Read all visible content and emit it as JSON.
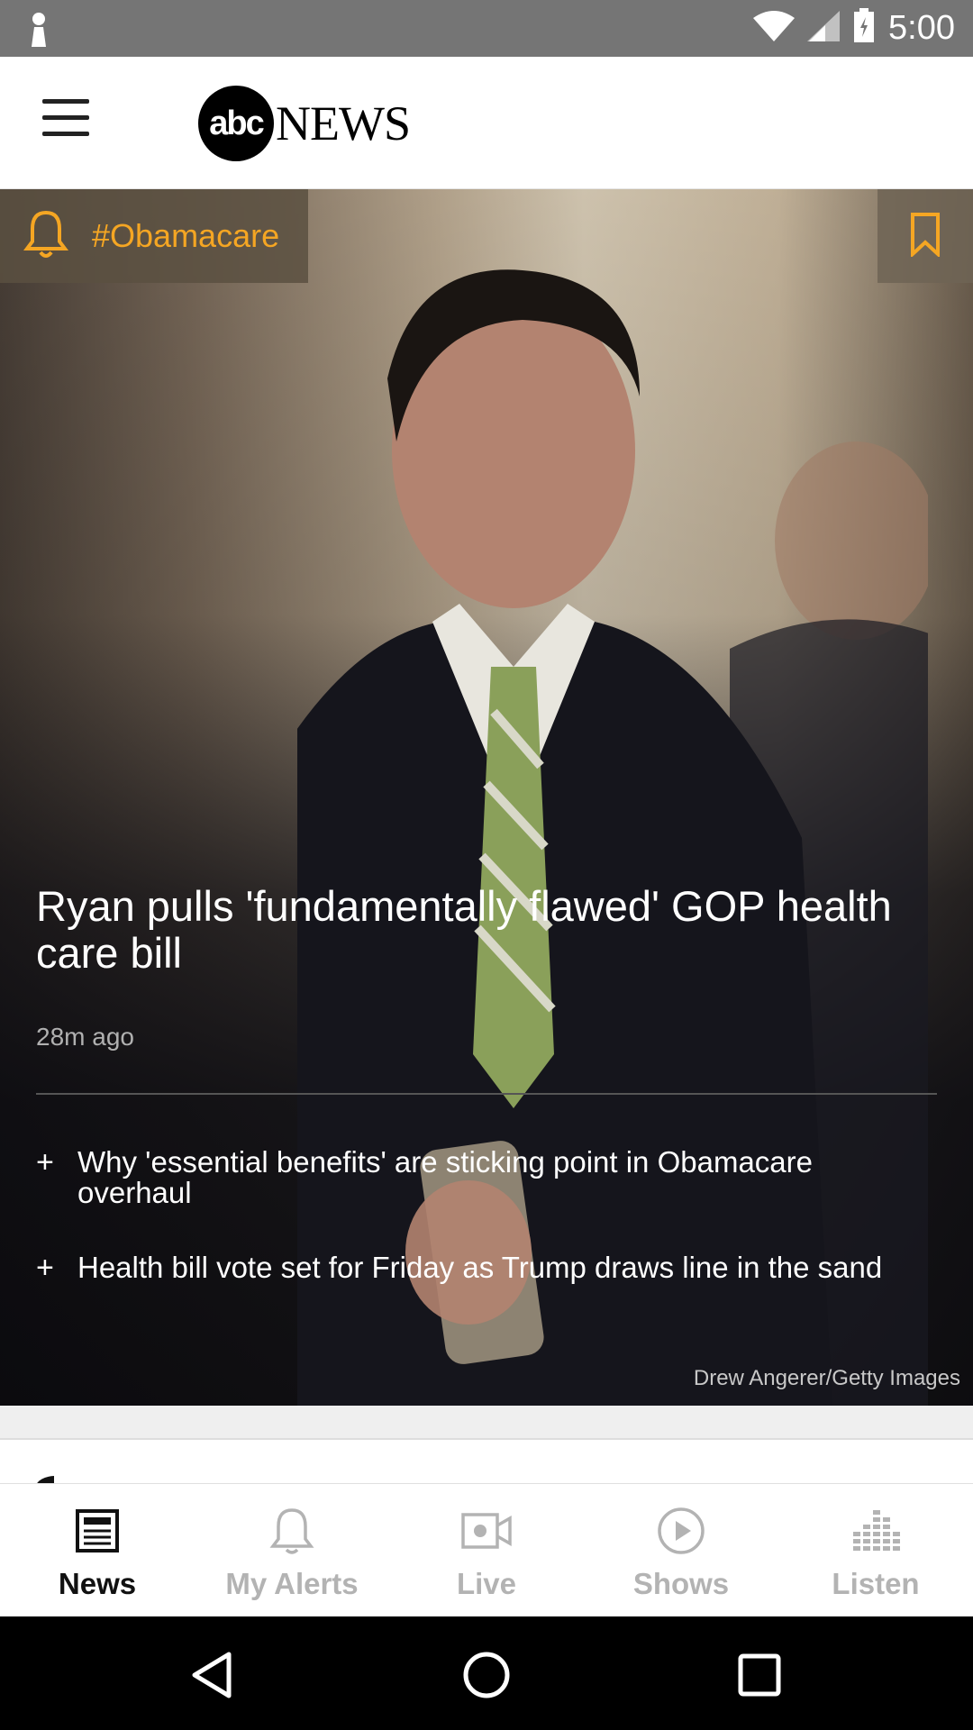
{
  "status_bar": {
    "time": "5:00"
  },
  "header": {
    "logo_abc": "abc",
    "logo_news": "NEWS"
  },
  "hero": {
    "topic": "#Obamacare",
    "headline": "Ryan pulls 'fundamentally flawed' GOP health care bill",
    "timestamp": "28m ago",
    "related": [
      {
        "plus": "+",
        "text": "Why 'essential benefits' are sticking point in Obamacare overhaul"
      },
      {
        "plus": "+",
        "text": "Health bill vote set for Friday as Trump draws line in the sand"
      }
    ],
    "photo_credit": "Drew Angerer/Getty Images"
  },
  "bottom_nav": [
    {
      "label": "News",
      "icon": "news-icon",
      "active": true
    },
    {
      "label": "My Alerts",
      "icon": "bell-icon",
      "active": false
    },
    {
      "label": "Live",
      "icon": "video-camera-icon",
      "active": false
    },
    {
      "label": "Shows",
      "icon": "play-circle-icon",
      "active": false
    },
    {
      "label": "Listen",
      "icon": "equalizer-icon",
      "active": false
    }
  ],
  "colors": {
    "accent": "#f5a623",
    "status_bar": "#757575",
    "nav_active": "#111111",
    "nav_inactive": "#b3b3b3"
  }
}
